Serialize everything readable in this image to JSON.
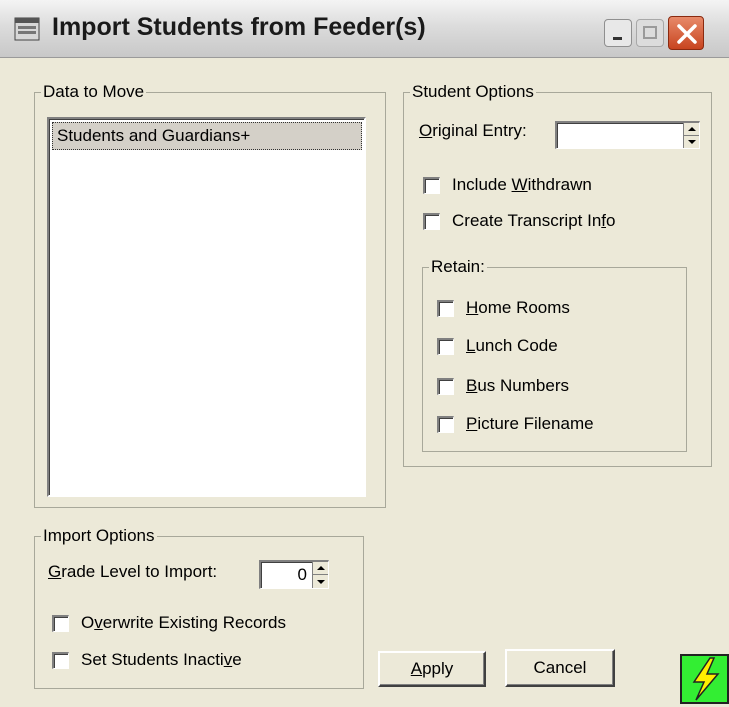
{
  "window": {
    "title": "Import Students from Feeder(s)"
  },
  "data_to_move": {
    "title": "Data to Move",
    "items": [
      "Students and Guardians+"
    ]
  },
  "student_options": {
    "title": "Student Options",
    "original_entry_prefix": "O",
    "original_entry_rest": "riginal Entry:",
    "original_entry_value": "",
    "include_withdrawn_pre": "Include ",
    "include_withdrawn_u": "W",
    "include_withdrawn_post": "ithdrawn",
    "include_withdrawn_checked": false,
    "create_transcript_pre": "Create Transcript In",
    "create_transcript_u": "f",
    "create_transcript_post": "o",
    "create_transcript_checked": false
  },
  "retain": {
    "title": "Retain:",
    "home_rooms_u": "H",
    "home_rooms_rest": "ome Rooms",
    "lunch_code_u": "L",
    "lunch_code_rest": "unch Code",
    "bus_numbers_u": "B",
    "bus_numbers_rest": "us Numbers",
    "picture_filename_u": "P",
    "picture_filename_rest": "icture Filename"
  },
  "import_options": {
    "title": "Import Options",
    "grade_level_u": "G",
    "grade_level_rest": "rade Level to Import:",
    "grade_level_value": "0",
    "overwrite_pre": "O",
    "overwrite_u": "v",
    "overwrite_post": "erwrite Existing Records",
    "inactive_pre": "Set Students Inacti",
    "inactive_u": "v",
    "inactive_post": "e"
  },
  "buttons": {
    "apply_u": "A",
    "apply_rest": "pply",
    "cancel": "Cancel"
  },
  "icons": {
    "app": "window-app-icon",
    "minimize": "minimize-icon",
    "maximize": "maximize-icon",
    "close": "close-icon",
    "status": "lightning-icon"
  },
  "colors": {
    "window_bg": "#ece9d8",
    "close_button": "#c8441f",
    "status_icon": "#33ee33",
    "lightning": "#ffee00"
  }
}
